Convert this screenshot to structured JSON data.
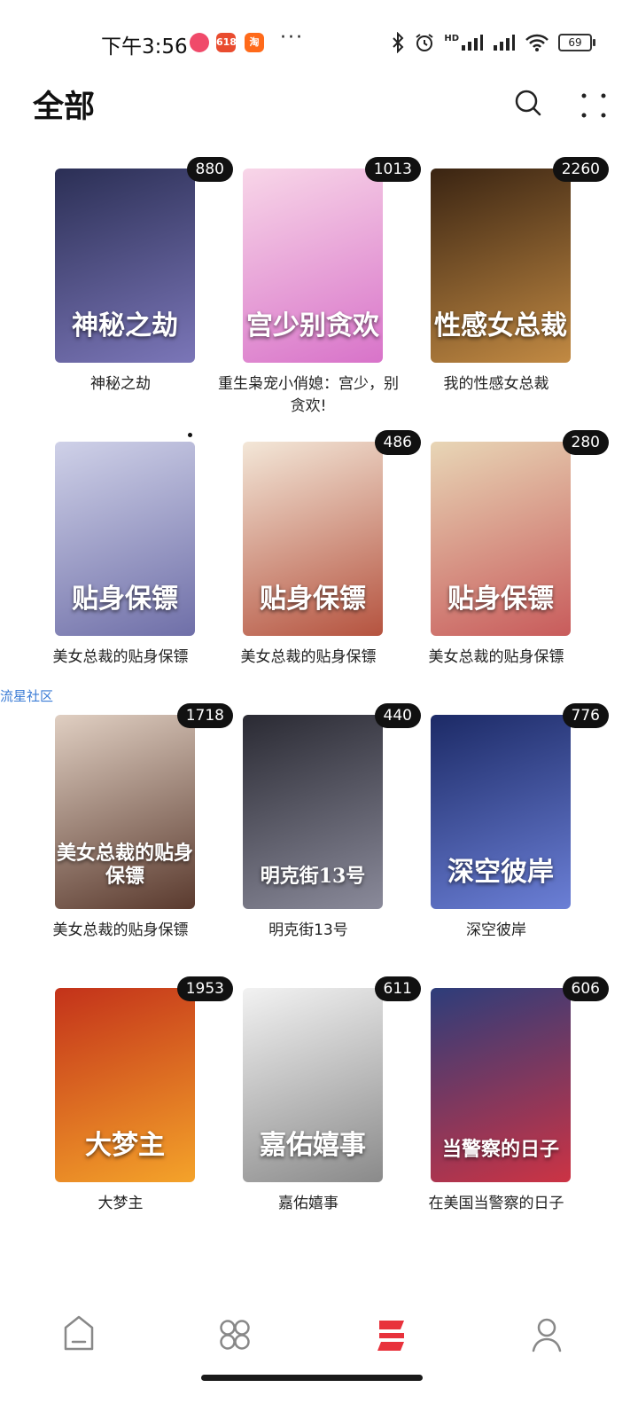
{
  "status_bar": {
    "time": "下午3:56",
    "app_badges": [
      "618",
      "淘"
    ],
    "more": "···",
    "signal_label": "HD",
    "battery": "69"
  },
  "header": {
    "title": "全部",
    "search_icon": "search-icon",
    "more_icon": "grid-more-icon"
  },
  "side_label": "流星社区",
  "books": [
    {
      "title": "神秘之劫",
      "count": "880",
      "cover_text": "神秘之劫",
      "colors": [
        "#2b2f55",
        "#7b76b8"
      ]
    },
    {
      "title": "重生枭宠小俏媳：宫少，别贪欢!",
      "count": "1013",
      "cover_text": "宫少别贪欢",
      "colors": [
        "#f8d6e8",
        "#d873c9"
      ]
    },
    {
      "title": "我的性感女总裁",
      "count": "2260",
      "cover_text": "性感女总裁",
      "colors": [
        "#3a2412",
        "#c28a43"
      ]
    },
    {
      "title": "美女总裁的贴身保镖",
      "count": "",
      "cover_text": "贴身保镖",
      "colors": [
        "#cfd1e8",
        "#6f6fa8"
      ]
    },
    {
      "title": "美女总裁的贴身保镖",
      "count": "486",
      "cover_text": "贴身保镖",
      "colors": [
        "#f3e7d8",
        "#b5533f"
      ]
    },
    {
      "title": "美女总裁的贴身保镖",
      "count": "280",
      "cover_text": "贴身保镖",
      "colors": [
        "#e8d6b6",
        "#c85b5b"
      ]
    },
    {
      "title": "美女总裁的贴身保镖",
      "count": "1718",
      "cover_text": "美女总裁的贴身保镖",
      "colors": [
        "#e0cfc2",
        "#5a3a2e"
      ]
    },
    {
      "title": "明克街13号",
      "count": "440",
      "cover_text": "明克街13号",
      "colors": [
        "#2a2a33",
        "#8a8a9a"
      ]
    },
    {
      "title": "深空彼岸",
      "count": "776",
      "cover_text": "深空彼岸",
      "colors": [
        "#1c2a66",
        "#6b7fd6"
      ]
    },
    {
      "title": "大梦主",
      "count": "1953",
      "cover_text": "大梦主",
      "colors": [
        "#c3321a",
        "#f4a32a"
      ]
    },
    {
      "title": "嘉佑嬉事",
      "count": "611",
      "cover_text": "嘉佑嬉事",
      "colors": [
        "#f2f2f2",
        "#8a8a8a"
      ]
    },
    {
      "title": "在美国当警察的日子",
      "count": "606",
      "cover_text": "当警察的日子",
      "colors": [
        "#2d3d7a",
        "#cc3344"
      ]
    }
  ],
  "bottom_nav": [
    {
      "name": "home",
      "icon": "home-icon",
      "active": false
    },
    {
      "name": "categories",
      "icon": "grid-icon",
      "active": false
    },
    {
      "name": "bookshelf",
      "icon": "bookshelf-icon",
      "active": true
    },
    {
      "name": "profile",
      "icon": "person-icon",
      "active": false
    }
  ],
  "accent_color": "#e8323c"
}
